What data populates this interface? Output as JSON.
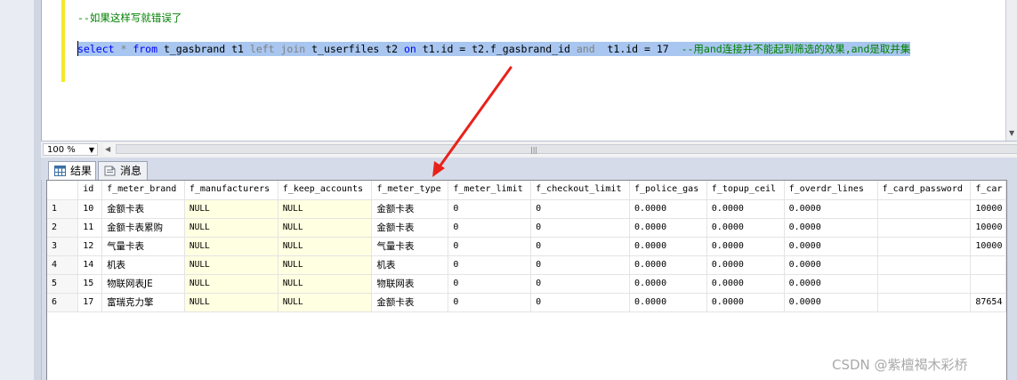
{
  "editor": {
    "comment_line": "--如果这样写就错误了",
    "query": {
      "select_kw": "select",
      "star_from": " * ",
      "from_kw": "from",
      "table1": " t_gasbrand t1 ",
      "left_join_kw": "left join",
      "table2": " t_userfiles t2 ",
      "on_kw": "on",
      "condition": " t1.id = t2.f_gasbrand_id ",
      "and_kw": "and",
      "condition2": "  t1.id = 17  ",
      "trailing_comment": "--用and连接并不能起到筛选的效果,and是取并集"
    }
  },
  "statusbar": {
    "zoom": "100 %",
    "hscroll_grip": "|||"
  },
  "tabs": [
    {
      "label": "结果",
      "icon": "grid-results-icon"
    },
    {
      "label": "消息",
      "icon": "messages-icon"
    }
  ],
  "grid": {
    "columns": [
      "",
      "id",
      "f_meter_brand",
      "f_manufacturers",
      "f_keep_accounts",
      "f_meter_type",
      "f_meter_limit",
      "f_checkout_limit",
      "f_police_gas",
      "f_topup_ceil",
      "f_overdr_lines",
      "f_card_password",
      "f_car"
    ],
    "rows": [
      [
        "1",
        "10",
        "金额卡表",
        "NULL",
        "NULL",
        "金额卡表",
        "0",
        "0",
        "0.0000",
        "0.0000",
        "0.0000",
        "",
        "10000"
      ],
      [
        "2",
        "11",
        "金额卡表累购",
        "NULL",
        "NULL",
        "金额卡表",
        "0",
        "0",
        "0.0000",
        "0.0000",
        "0.0000",
        "",
        "10000"
      ],
      [
        "3",
        "12",
        "气量卡表",
        "NULL",
        "NULL",
        "气量卡表",
        "0",
        "0",
        "0.0000",
        "0.0000",
        "0.0000",
        "",
        "10000"
      ],
      [
        "4",
        "14",
        "机表",
        "NULL",
        "NULL",
        "机表",
        "0",
        "0",
        "0.0000",
        "0.0000",
        "0.0000",
        "",
        ""
      ],
      [
        "5",
        "15",
        "物联网表JE",
        "NULL",
        "NULL",
        "物联网表",
        "0",
        "0",
        "0.0000",
        "0.0000",
        "0.0000",
        "",
        ""
      ],
      [
        "6",
        "17",
        "富瑞克力擎",
        "NULL",
        "NULL",
        "金额卡表",
        "0",
        "0",
        "0.0000",
        "0.0000",
        "0.0000",
        "",
        "87654"
      ]
    ]
  },
  "watermark": "CSDN @紫檀褐木彩桥",
  "colors": {
    "annotation_arrow": "#e8221b",
    "selection": "#a8c6ef",
    "null_cell": "#ffffe1"
  }
}
